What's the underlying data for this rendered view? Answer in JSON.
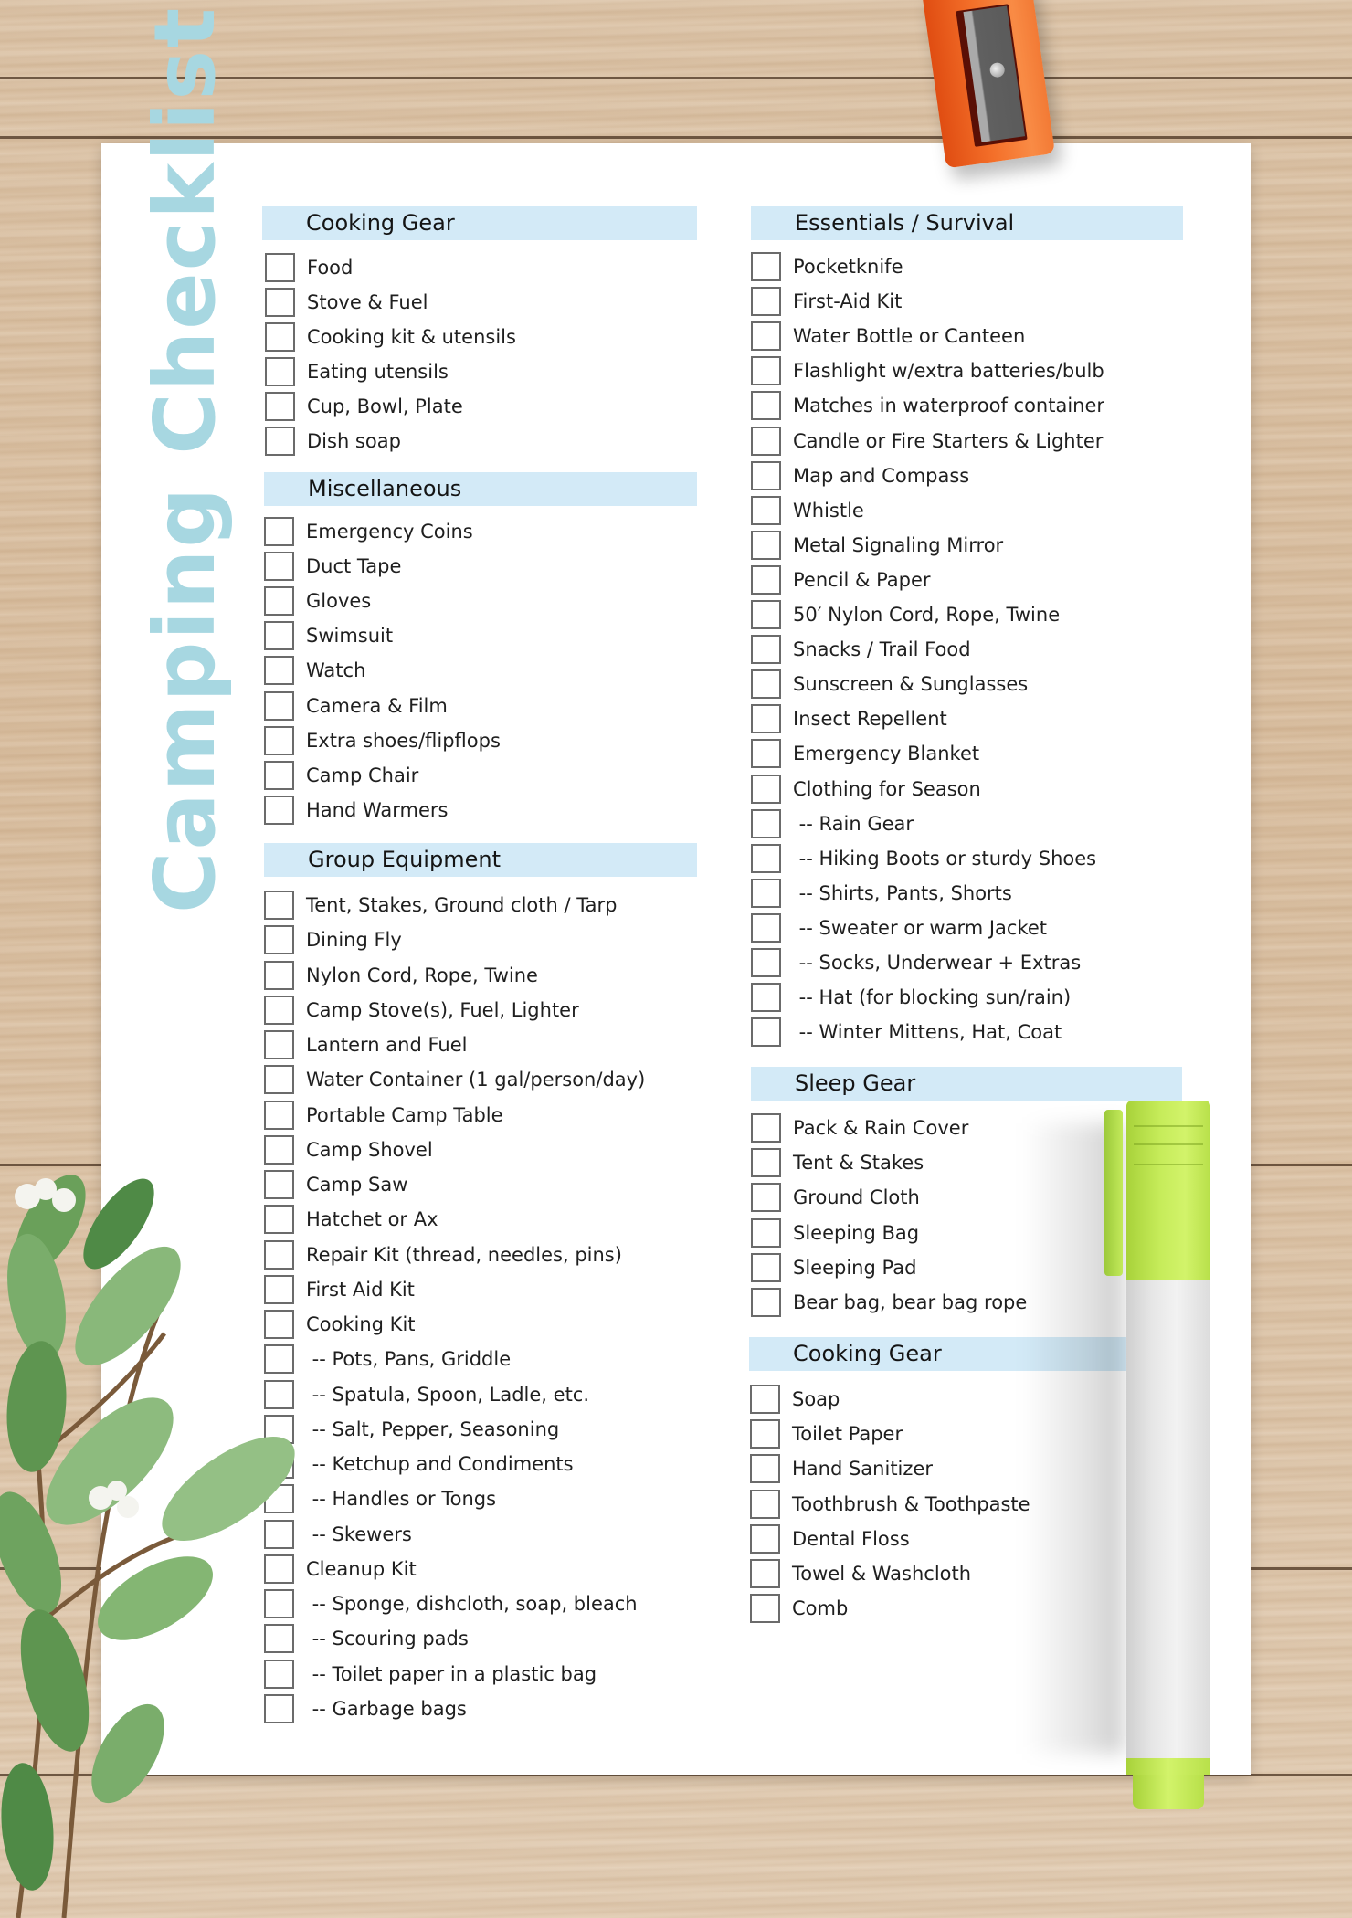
{
  "title": "Camping Checklist",
  "colors": {
    "title": "#a7d7e1",
    "section_header_bg": "#d3eaf7",
    "paper": "#ffffff",
    "sharpener": "#f06a24",
    "marker_cap": "#c6ec5a"
  },
  "sections": {
    "cooking_gear": {
      "heading": "Cooking Gear",
      "items": [
        "Food",
        "Stove & Fuel",
        "Cooking kit & utensils",
        "Eating utensils",
        "Cup, Bowl, Plate",
        "Dish soap"
      ]
    },
    "miscellaneous": {
      "heading": "Miscellaneous",
      "items": [
        "Emergency Coins",
        "Duct Tape",
        "Gloves",
        "Swimsuit",
        "Watch",
        "Camera & Film",
        "Extra shoes/flipflops",
        "Camp Chair",
        "Hand Warmers"
      ]
    },
    "group_equipment": {
      "heading": "Group Equipment",
      "items": [
        "Tent, Stakes, Ground cloth / Tarp",
        "Dining Fly",
        "Nylon Cord, Rope, Twine",
        "Camp Stove(s), Fuel, Lighter",
        "Lantern and Fuel",
        "Water Container (1 gal/person/day)",
        "Portable Camp Table",
        "Camp Shovel",
        "Camp Saw",
        "Hatchet or Ax",
        "Repair Kit (thread, needles, pins)",
        "First Aid Kit",
        "Cooking Kit",
        " -- Pots, Pans, Griddle",
        " -- Spatula, Spoon, Ladle, etc.",
        " -- Salt, Pepper, Seasoning",
        " -- Ketchup and Condiments",
        " -- Handles or Tongs",
        " -- Skewers",
        "Cleanup Kit",
        " -- Sponge, dishcloth, soap, bleach",
        " -- Scouring pads",
        " -- Toilet paper in a plastic bag",
        " -- Garbage bags"
      ]
    },
    "essentials_survival": {
      "heading": "Essentials / Survival",
      "items": [
        "Pocketknife",
        "First-Aid Kit",
        "Water Bottle or Canteen",
        "Flashlight w/extra batteries/bulb",
        "Matches in waterproof container",
        "Candle or Fire Starters & Lighter",
        "Map and Compass",
        "Whistle",
        "Metal Signaling Mirror",
        "Pencil & Paper",
        "50′ Nylon Cord, Rope, Twine",
        "Snacks / Trail Food",
        "Sunscreen & Sunglasses",
        "Insect Repellent",
        "Emergency Blanket",
        "Clothing for Season",
        " -- Rain Gear",
        " -- Hiking Boots or sturdy Shoes",
        " -- Shirts, Pants, Shorts",
        " -- Sweater or warm Jacket",
        " -- Socks, Underwear + Extras",
        " -- Hat (for blocking sun/rain)",
        " -- Winter Mittens, Hat, Coat"
      ]
    },
    "sleep_gear": {
      "heading": "Sleep Gear",
      "items": [
        "Pack & Rain Cover",
        "Tent & Stakes",
        "Ground Cloth",
        "Sleeping Bag",
        "Sleeping Pad",
        "Bear bag, bear bag rope"
      ]
    },
    "cooking_gear_2": {
      "heading": "Cooking Gear",
      "items": [
        "Soap",
        "Toilet Paper",
        "Hand Sanitizer",
        "Toothbrush & Toothpaste",
        "Dental Floss",
        "Towel & Washcloth",
        "Comb"
      ]
    }
  }
}
